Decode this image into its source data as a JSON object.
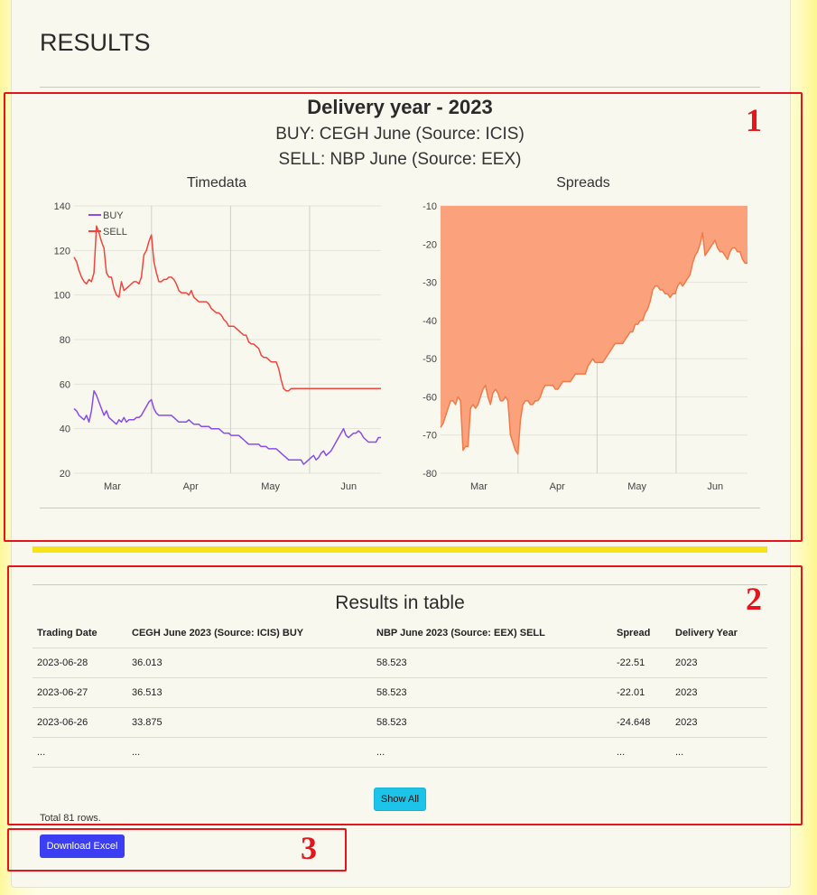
{
  "page": {
    "title": "RESULTS"
  },
  "delivery": {
    "year_title": "Delivery year - 2023",
    "buy_line": "BUY: CEGH June (Source: ICIS)",
    "sell_line": "SELL: NBP June (Source: EEX)"
  },
  "chart_data": [
    {
      "type": "line",
      "title": "Timedata",
      "xlabel": "",
      "ylabel": "",
      "ylim": [
        20,
        140
      ],
      "yticks": [
        20,
        40,
        60,
        80,
        100,
        120,
        140
      ],
      "month_ticks": [
        {
          "label": "Mar",
          "t": 0.125
        },
        {
          "label": "Apr",
          "t": 0.38
        },
        {
          "label": "May",
          "t": 0.64
        },
        {
          "label": "Jun",
          "t": 0.895
        }
      ],
      "grid": true,
      "legend": "top-left",
      "series": [
        {
          "name": "BUY",
          "color": "#8a4cf0",
          "values": [
            49,
            48,
            46,
            45,
            44,
            46,
            43,
            48,
            57,
            55,
            52,
            49,
            46,
            48,
            45,
            44,
            43,
            42,
            44,
            43,
            45,
            43,
            44,
            44,
            44,
            45,
            45,
            46,
            48,
            50,
            52,
            53,
            49,
            47,
            46,
            46,
            46,
            46,
            46,
            46,
            45,
            44,
            43,
            43,
            43,
            43,
            44,
            43,
            42,
            42,
            42,
            41,
            41,
            41,
            41,
            40,
            40,
            40,
            40,
            39,
            38,
            38,
            38,
            37,
            37,
            37,
            37,
            36,
            35,
            34,
            33,
            33,
            33,
            33,
            33,
            32,
            32,
            32,
            31,
            31,
            31,
            31,
            30,
            29,
            28,
            27,
            26,
            26,
            26,
            26,
            26,
            26,
            24,
            25,
            26,
            27,
            28,
            26,
            27,
            29,
            30,
            28,
            29,
            30,
            32,
            34,
            36,
            38,
            40,
            37,
            36,
            37,
            38,
            38,
            39,
            38,
            36,
            35,
            34,
            34,
            34,
            34,
            36,
            36
          ]
        },
        {
          "name": "SELL",
          "color": "#f2453f",
          "values": [
            117,
            115,
            111,
            108,
            106,
            105,
            107,
            106,
            110,
            131,
            128,
            124,
            121,
            110,
            108,
            108,
            103,
            100,
            99,
            106,
            102,
            103,
            104,
            105,
            106,
            106,
            105,
            108,
            118,
            120,
            124,
            127,
            115,
            110,
            106,
            106,
            107,
            107,
            108,
            108,
            107,
            105,
            102,
            101,
            101,
            101,
            100,
            102,
            99,
            98,
            97,
            97,
            97,
            97,
            96,
            94,
            93,
            92,
            92,
            91,
            89,
            88,
            86,
            86,
            86,
            85,
            84,
            83,
            82,
            82,
            79,
            78,
            78,
            77,
            76,
            73,
            72,
            72,
            71,
            70,
            70,
            70,
            67,
            62,
            58,
            57,
            57,
            58,
            58,
            58,
            58,
            58,
            58,
            58,
            58,
            58,
            58,
            58,
            58,
            58,
            58,
            58,
            58,
            58,
            58,
            58,
            58,
            58,
            58,
            58,
            58,
            58,
            58,
            58,
            58,
            58,
            58,
            58,
            58,
            58,
            58,
            58,
            58,
            58
          ]
        }
      ]
    },
    {
      "type": "area",
      "title": "Spreads",
      "xlabel": "",
      "ylabel": "",
      "ylim": [
        -80,
        -10
      ],
      "yticks": [
        -10,
        -20,
        -30,
        -40,
        -50,
        -60,
        -70,
        -80
      ],
      "month_ticks": [
        {
          "label": "Mar",
          "t": 0.125
        },
        {
          "label": "Apr",
          "t": 0.38
        },
        {
          "label": "May",
          "t": 0.64
        },
        {
          "label": "Jun",
          "t": 0.895
        }
      ],
      "grid": true,
      "legend": "none",
      "series": [
        {
          "name": "",
          "color": "#f07a4a",
          "fill": "#fba27c",
          "values": [
            -68,
            -67,
            -65,
            -63,
            -61,
            -61,
            -62,
            -60,
            -61,
            -74,
            -73,
            -73,
            -63,
            -62,
            -63,
            -62,
            -60,
            -58,
            -57,
            -60,
            -62,
            -59,
            -58,
            -59,
            -61,
            -61,
            -60,
            -61,
            -70,
            -72,
            -74,
            -75,
            -66,
            -62,
            -61,
            -61,
            -62,
            -62,
            -61,
            -61,
            -60,
            -58,
            -57,
            -57,
            -57,
            -57,
            -58,
            -58,
            -57,
            -56,
            -56,
            -56,
            -56,
            -55,
            -54,
            -54,
            -54,
            -54,
            -54,
            -52,
            -51,
            -50,
            -51,
            -51,
            -51,
            -51,
            -50,
            -49,
            -48,
            -47,
            -46,
            -46,
            -46,
            -46,
            -45,
            -44,
            -43,
            -43,
            -41,
            -41,
            -40,
            -40,
            -38,
            -37,
            -35,
            -32,
            -31,
            -31,
            -32,
            -32,
            -33,
            -33,
            -34,
            -33,
            -33,
            -31,
            -30,
            -31,
            -30,
            -29,
            -28,
            -25,
            -23,
            -22,
            -20,
            -17,
            -23,
            -22,
            -21,
            -20,
            -19,
            -21,
            -22,
            -22,
            -23,
            -24,
            -22,
            -21,
            -21,
            -22,
            -22,
            -24,
            -25,
            -25
          ]
        }
      ]
    }
  ],
  "table": {
    "title": "Results in table",
    "columns": [
      "Trading Date",
      "CEGH June 2023 (Source: ICIS) BUY",
      "NBP June 2023 (Source: EEX) SELL",
      "Spread",
      "Delivery Year"
    ],
    "rows": [
      [
        "2023-06-28",
        "36.013",
        "58.523",
        "-22.51",
        "2023"
      ],
      [
        "2023-06-27",
        "36.513",
        "58.523",
        "-22.01",
        "2023"
      ],
      [
        "2023-06-26",
        "33.875",
        "58.523",
        "-24.648",
        "2023"
      ],
      [
        "...",
        "...",
        "...",
        "...",
        "..."
      ]
    ],
    "show_all_label": "Show All",
    "total_rows_text": "Total 81 rows."
  },
  "download": {
    "label": "Download Excel"
  },
  "annotations": {
    "box1": "1",
    "box2": "2",
    "box3": "3"
  },
  "colors": {
    "annotation_red": "#e8141c",
    "show_all_bg": "#1bc4e8",
    "download_bg": "#3b3ef2",
    "separator_yellow": "#f8e21a"
  }
}
